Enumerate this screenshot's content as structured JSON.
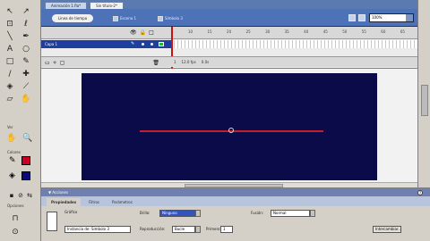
{
  "document_tabs": [
    {
      "label": "Animación 1.fla*",
      "active": false
    },
    {
      "label": "Sin título-2*",
      "active": true
    }
  ],
  "edit_bar": {
    "scene_pill": "Linea de tiempo",
    "crumbs": [
      "Escena 1",
      "Símbolo 3"
    ],
    "zoom_value": "100%"
  },
  "timeline": {
    "layer_name": "Capa 1",
    "ruler_ticks": [
      "5",
      "10",
      "15",
      "20",
      "25",
      "30",
      "35",
      "40",
      "45",
      "50",
      "55",
      "60",
      "65"
    ],
    "footer_stats": [
      "1",
      "12.0 fps",
      "0.0s"
    ]
  },
  "tools": {
    "view_label": "Ver",
    "colors_label": "Colores",
    "options_label": "Opciones"
  },
  "properties": {
    "panel_title": "▼ Acciones",
    "tabs": [
      {
        "label": "Propiedades",
        "active": true
      },
      {
        "label": "Filtros",
        "active": false
      },
      {
        "label": "Parámetros",
        "active": false
      }
    ],
    "graphic_label": "Gráfico",
    "instance_field": "Instancia de: Símbolo 3",
    "brightness_label": "Brillo:",
    "brightness_value": "Ninguno",
    "loop_label": "Reproducción:",
    "loop_value": "Bucle",
    "first_label": "Primero:",
    "first_value": "1",
    "blend_label": "Fusión:",
    "blend_value": "Normal",
    "swap_button": "Intercambiar..."
  },
  "colors": {
    "stage": "#0c0b4a",
    "line": "#c2202e",
    "stroke": "#cc0022",
    "fill": "#0a0a7a",
    "edit_bar": "#4d72b7"
  }
}
